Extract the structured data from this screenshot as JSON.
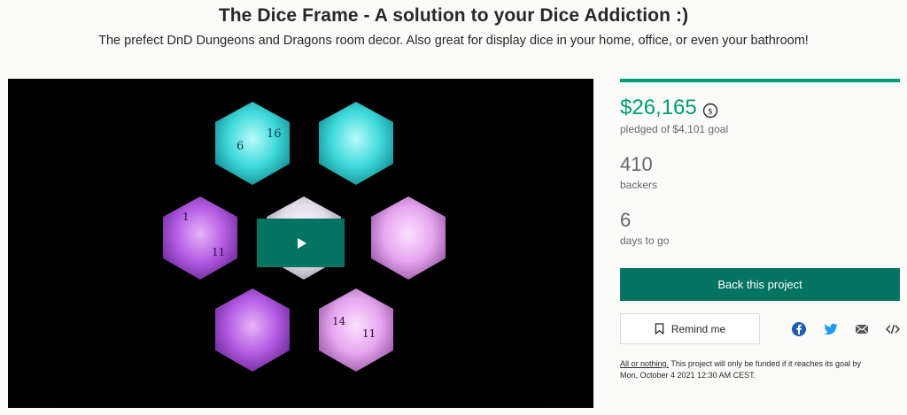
{
  "header": {
    "title": "The Dice Frame - A solution to your Dice Addiction :)",
    "subtitle": "The prefect DnD Dungeons and Dragons room decor. Also great for display dice in your home, office, or even your bathroom!"
  },
  "video": {
    "play_icon": "play-icon",
    "dice_colors": [
      "#35d6d8",
      "#35d6d8",
      "#b85be6",
      "#efeaf2",
      "#e7a9f0",
      "#c06ae8",
      "#ecaef3"
    ]
  },
  "funding": {
    "progress": 1.0,
    "pledged_amount": "$26,165",
    "currency_icon": "currency-conversion-icon",
    "pledged_label": "pledged of $4,101 goal",
    "backers_count": "410",
    "backers_label": "backers",
    "days_count": "6",
    "days_label": "days to go"
  },
  "actions": {
    "back_label": "Back this project",
    "remind_label": "Remind me",
    "remind_icon": "bookmark-icon"
  },
  "share": {
    "icons": [
      "facebook-icon",
      "twitter-icon",
      "email-icon",
      "embed-icon"
    ]
  },
  "footnote": {
    "link": "All or nothing.",
    "text": " This project will only be funded if it reaches its goal by",
    "date": "Mon, October 4 2021 12:30 AM CEST."
  },
  "colors": {
    "accent": "#009e74",
    "button": "#037362",
    "muted": "#656969"
  }
}
